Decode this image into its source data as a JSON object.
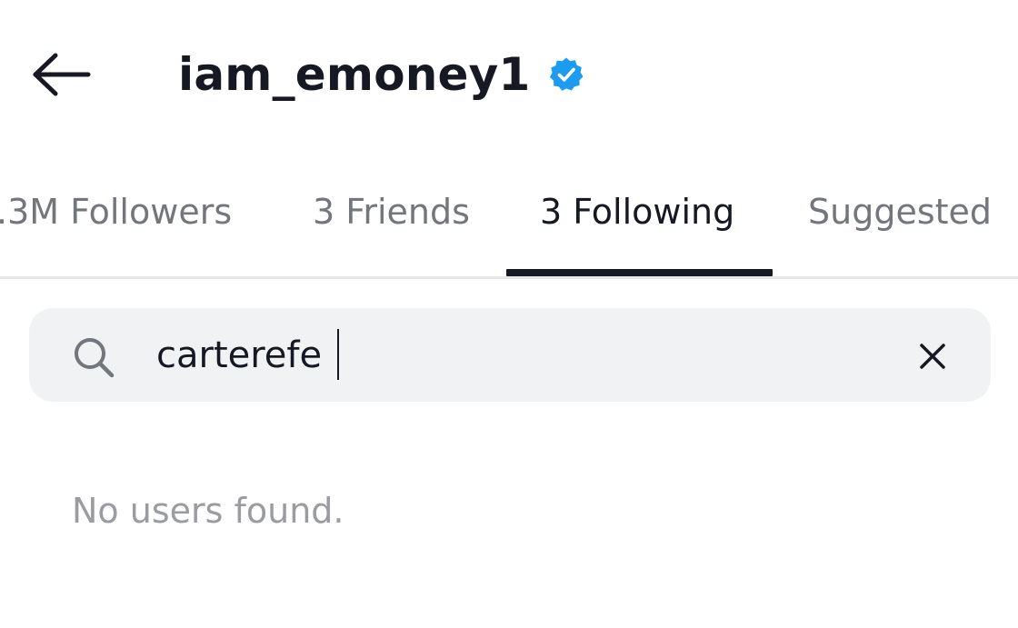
{
  "header": {
    "back_icon": "arrow-left-icon",
    "username": "iam_emoney1",
    "verified_icon": "verified-badge-icon",
    "verified_color": "#1d9bf0"
  },
  "tabs": [
    {
      "label": ".3M Followers",
      "active": false
    },
    {
      "label": "3 Friends",
      "active": false
    },
    {
      "label": "3 Following",
      "active": true
    },
    {
      "label": "Suggested",
      "active": false
    }
  ],
  "search": {
    "icon": "search-icon",
    "value": "carterefe",
    "clear_icon": "close-icon"
  },
  "results": {
    "empty_message": "No users found."
  },
  "colors": {
    "text_primary": "#161823",
    "text_secondary": "#73767d",
    "text_muted": "#9a9ca2",
    "search_bg": "#f1f2f4",
    "divider": "#e6e7e9"
  }
}
